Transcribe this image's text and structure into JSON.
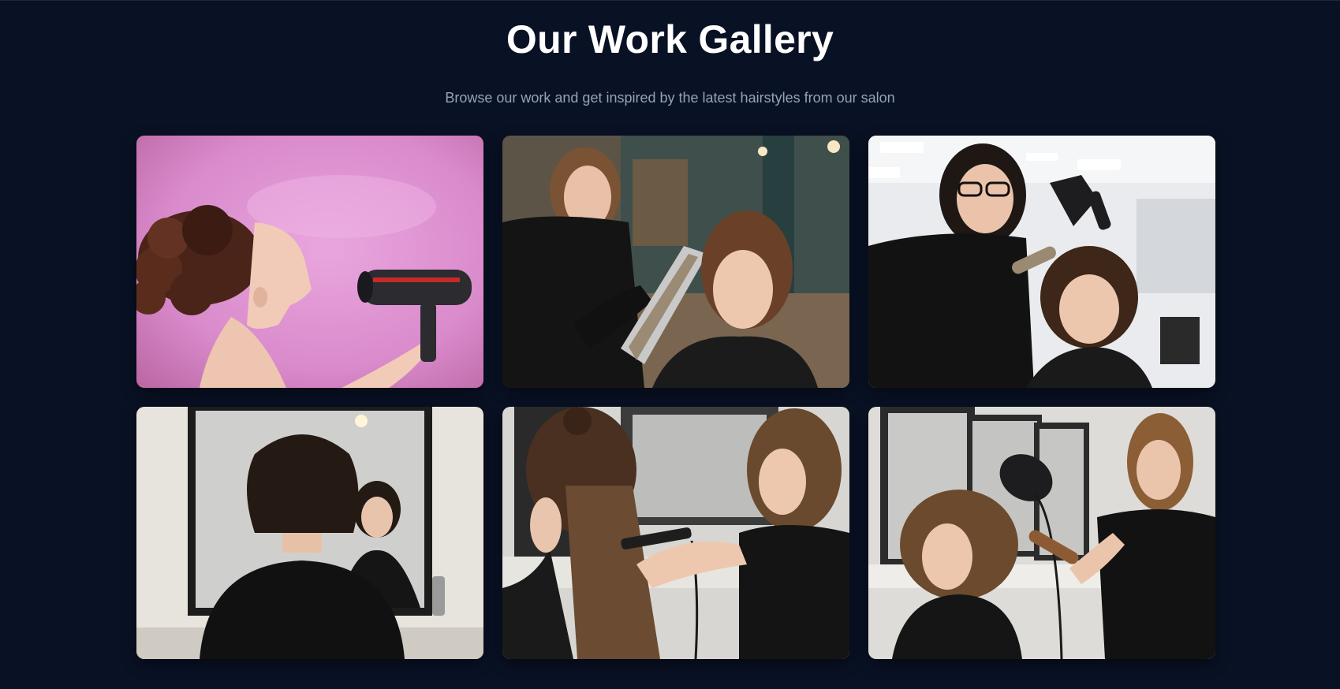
{
  "header": {
    "title": "Our Work Gallery",
    "subtitle": "Browse our work and get inspired by the latest hairstyles from our salon"
  },
  "colors": {
    "background": "#091124",
    "title": "#ffffff",
    "subtitle": "#94a3b8"
  },
  "gallery": {
    "items": [
      {
        "image": "woman-curly-updo-blow-dryer-pink-background"
      },
      {
        "image": "stylist-applying-foil-highlights"
      },
      {
        "image": "stylist-blow-drying-with-round-brush"
      },
      {
        "image": "client-bob-haircut-mirror-reflection"
      },
      {
        "image": "stylist-crimping-long-hair"
      },
      {
        "image": "stylist-blow-drying-crimped-bob"
      }
    ]
  }
}
